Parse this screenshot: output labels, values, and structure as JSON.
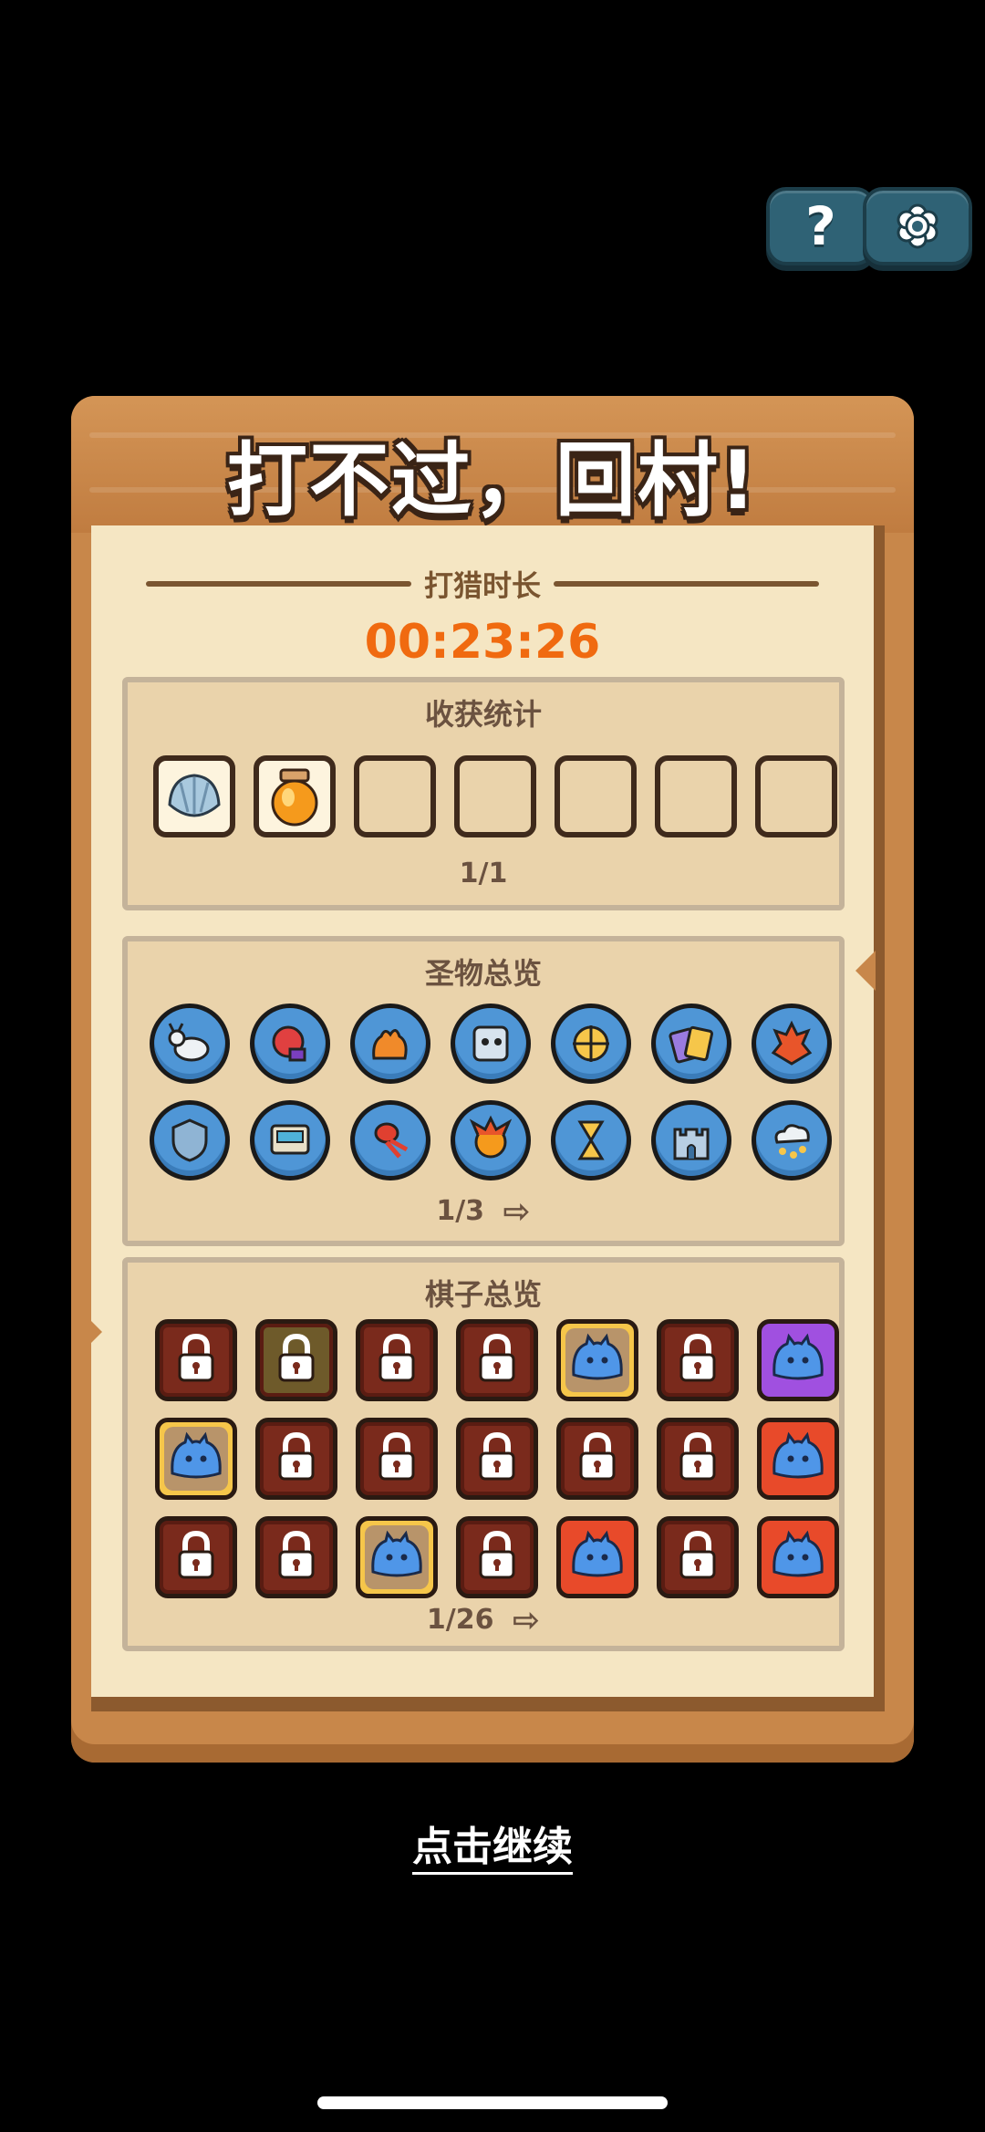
{
  "top_buttons": {
    "help_icon": "question-mark",
    "settings_icon": "gear",
    "help_glyph": "?"
  },
  "dialog": {
    "title": "打不过，回村!",
    "hunt_time_label": "打猎时长",
    "hunt_time": "00:23:26"
  },
  "harvest": {
    "title": "收获统计",
    "slots": [
      "shell",
      "honey-jar",
      "",
      "",
      "",
      "",
      ""
    ],
    "pager": "1/1"
  },
  "relics": {
    "title": "圣物总览",
    "items": [
      "goat",
      "boxing-glove",
      "flame-hand",
      "snow-face",
      "crosshair-gear",
      "cards",
      "fire-demon",
      "shield",
      "machine",
      "squid",
      "fireball",
      "hourglass",
      "castle",
      "cloud-rain"
    ],
    "pager": "1/3",
    "arrow": "⇨"
  },
  "pieces": {
    "title": "棋子总览",
    "items": [
      "locked",
      "locked-olive",
      "locked",
      "locked",
      "slime-gold",
      "locked",
      "slime-purple",
      "slime-gold",
      "locked",
      "locked",
      "locked",
      "locked",
      "locked",
      "slime-red",
      "locked",
      "locked",
      "slime-gold",
      "locked",
      "slime-red",
      "locked",
      "slime-red"
    ],
    "pager": "1/26",
    "arrow": "⇨"
  },
  "continue_label": "点击继续",
  "colors": {
    "timer": "#f06a10",
    "board": "#c8874a",
    "paper": "#f5e6c3",
    "relic_bg": "#4f96d6"
  }
}
